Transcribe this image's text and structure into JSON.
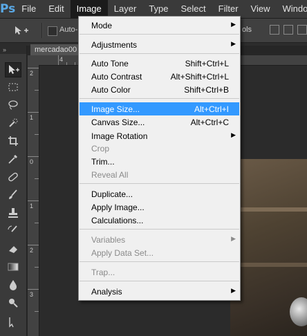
{
  "app": {
    "logo": "Ps"
  },
  "menubar": {
    "items": [
      {
        "label": "File"
      },
      {
        "label": "Edit"
      },
      {
        "label": "Image"
      },
      {
        "label": "Layer"
      },
      {
        "label": "Type"
      },
      {
        "label": "Select"
      },
      {
        "label": "Filter"
      },
      {
        "label": "View"
      },
      {
        "label": "Window"
      }
    ]
  },
  "options": {
    "auto_select_label": "Auto-",
    "right_label": "ols"
  },
  "document": {
    "tab_title": "mercadao00"
  },
  "rulers": {
    "top": [
      "4"
    ],
    "left": [
      "2",
      "1",
      "0",
      "1",
      "2",
      "3"
    ]
  },
  "image_menu": {
    "items": [
      {
        "label": "Mode",
        "shortcut": "",
        "submenu": true,
        "disabled": false
      },
      {
        "label": "Adjustments",
        "shortcut": "",
        "submenu": true,
        "disabled": false
      },
      {
        "label": "Auto Tone",
        "shortcut": "Shift+Ctrl+L",
        "submenu": false,
        "disabled": false
      },
      {
        "label": "Auto Contrast",
        "shortcut": "Alt+Shift+Ctrl+L",
        "submenu": false,
        "disabled": false
      },
      {
        "label": "Auto Color",
        "shortcut": "Shift+Ctrl+B",
        "submenu": false,
        "disabled": false
      },
      {
        "label": "Image Size...",
        "shortcut": "Alt+Ctrl+I",
        "submenu": false,
        "disabled": false,
        "highlighted": true
      },
      {
        "label": "Canvas Size...",
        "shortcut": "Alt+Ctrl+C",
        "submenu": false,
        "disabled": false
      },
      {
        "label": "Image Rotation",
        "shortcut": "",
        "submenu": true,
        "disabled": false
      },
      {
        "label": "Crop",
        "shortcut": "",
        "submenu": false,
        "disabled": true
      },
      {
        "label": "Trim...",
        "shortcut": "",
        "submenu": false,
        "disabled": false
      },
      {
        "label": "Reveal All",
        "shortcut": "",
        "submenu": false,
        "disabled": true
      },
      {
        "label": "Duplicate...",
        "shortcut": "",
        "submenu": false,
        "disabled": false
      },
      {
        "label": "Apply Image...",
        "shortcut": "",
        "submenu": false,
        "disabled": false
      },
      {
        "label": "Calculations...",
        "shortcut": "",
        "submenu": false,
        "disabled": false
      },
      {
        "label": "Variables",
        "shortcut": "",
        "submenu": true,
        "disabled": true
      },
      {
        "label": "Apply Data Set...",
        "shortcut": "",
        "submenu": false,
        "disabled": true
      },
      {
        "label": "Trap...",
        "shortcut": "",
        "submenu": false,
        "disabled": true
      },
      {
        "label": "Analysis",
        "shortcut": "",
        "submenu": true,
        "disabled": false
      }
    ]
  },
  "colors": {
    "highlight": "#3399ff",
    "menubar": "#3a3a3a",
    "menu_bg": "#f0f0f0"
  }
}
